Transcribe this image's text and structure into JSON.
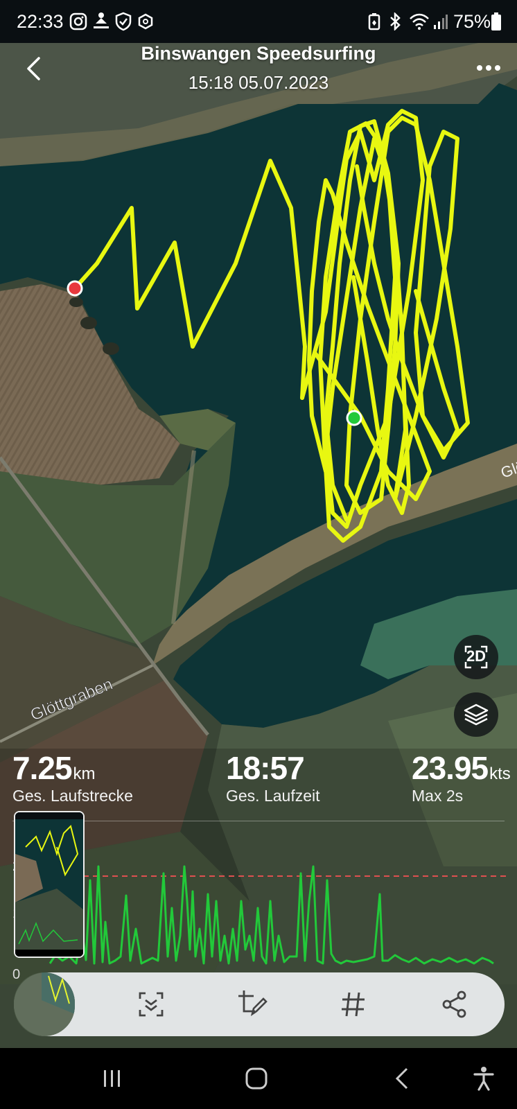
{
  "status_bar": {
    "time": "22:33",
    "battery": "75%",
    "left_icons": [
      "instagram-icon",
      "upload-person-icon",
      "shield-check-icon",
      "hexagon-icon"
    ],
    "right_icons": [
      "battery-saver-icon",
      "bluetooth-icon",
      "wifi-icon",
      "signal-icon",
      "battery-icon"
    ]
  },
  "header": {
    "title": "Binswangen Speedsurfing",
    "subtitle": "15:18 05.07.2023",
    "back_icon": "back-chevron-icon",
    "more_icon": "more-dots-icon"
  },
  "map": {
    "label_glottgraben": "Glöttgraben",
    "label_edge": "Glö",
    "track_color": "#e8f711",
    "start_marker_color": "#e8383d",
    "end_marker_color": "#22c93a",
    "view_mode_label": "2D",
    "layers_icon": "layers-icon"
  },
  "stats": {
    "distance": {
      "value": "7.25",
      "unit": "km",
      "label": "Ges. Laufstrecke"
    },
    "duration": {
      "value": "18:57",
      "unit": "",
      "label": "Ges. Laufzeit"
    },
    "speed": {
      "value": "23.95",
      "unit": "kts",
      "label": "Max 2s"
    }
  },
  "speed_chart": {
    "line_color": "#22c93a",
    "max_line_color": "#e05050",
    "tick_labels": [
      "2",
      "1",
      "0"
    ],
    "max_value": 23.95
  },
  "screenshot_toolbar": {
    "tools": [
      {
        "name": "scroll-capture-icon"
      },
      {
        "name": "crop-edit-icon"
      },
      {
        "name": "hashtag-icon"
      },
      {
        "name": "share-icon"
      }
    ]
  },
  "nav_bar": {
    "icons": [
      "recent-apps-icon",
      "home-icon",
      "back-icon",
      "accessibility-icon"
    ]
  },
  "colors": {
    "water": "#0d3436",
    "accent_track": "#e8f711"
  }
}
